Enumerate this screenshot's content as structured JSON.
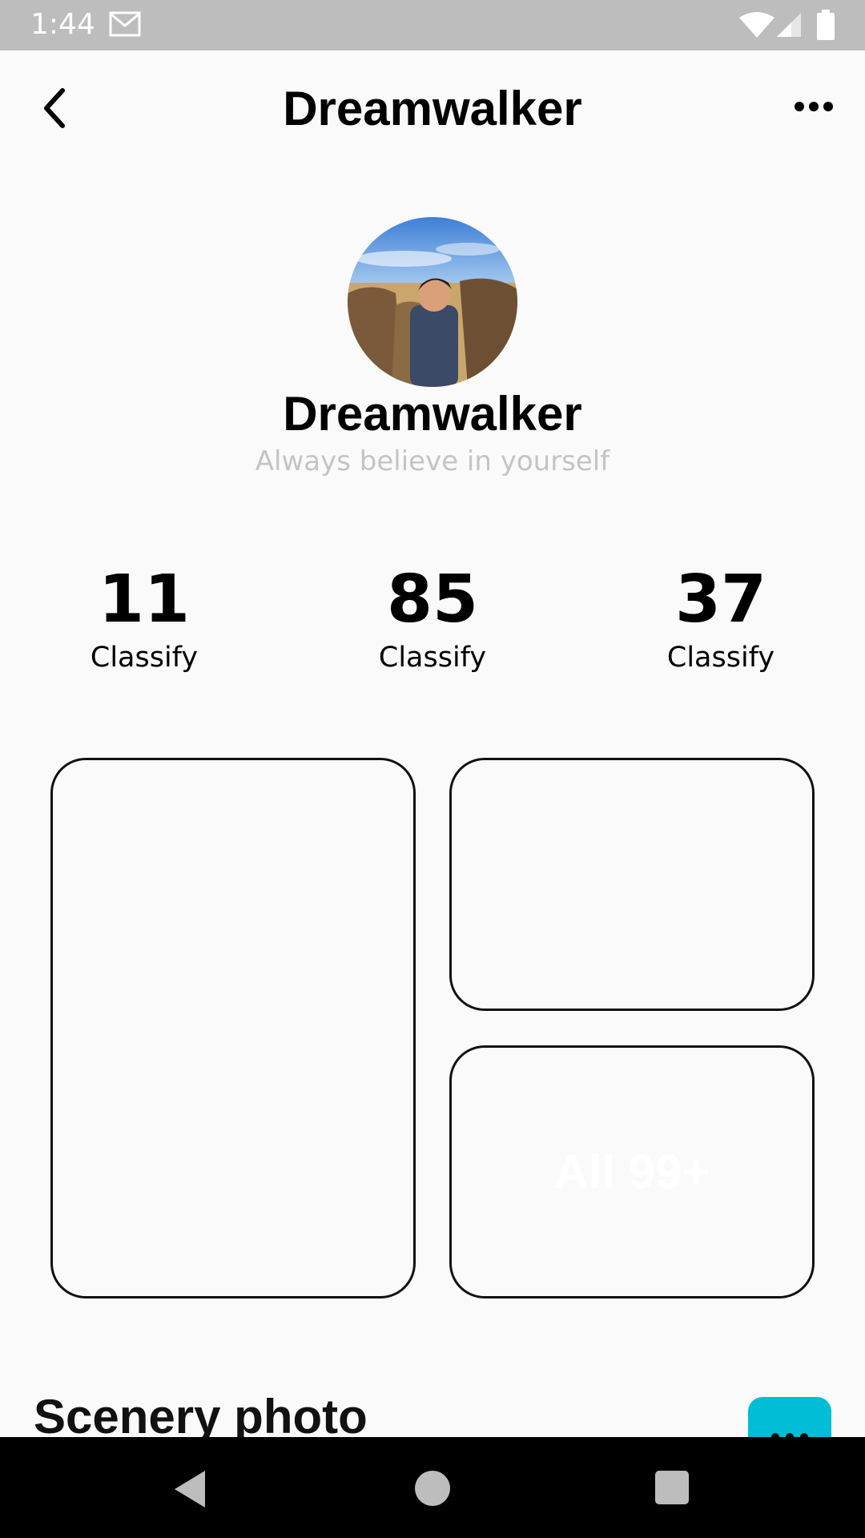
{
  "status_bar": {
    "time": "1:44"
  },
  "app_bar": {
    "title": "Dreamwalker"
  },
  "profile": {
    "name": "Dreamwalker",
    "bio": "Always believe in yourself"
  },
  "stats": [
    {
      "value": "11",
      "label": "Classify"
    },
    {
      "value": "85",
      "label": "Classify"
    },
    {
      "value": "37",
      "label": "Classify"
    }
  ],
  "cards": {
    "all_label": "All 99+"
  },
  "section": {
    "title": "Scenery photo"
  },
  "colors": {
    "accent": "#00bcd4",
    "status_bar": "#bdbdbd",
    "bio_text": "#c4c4c4"
  }
}
